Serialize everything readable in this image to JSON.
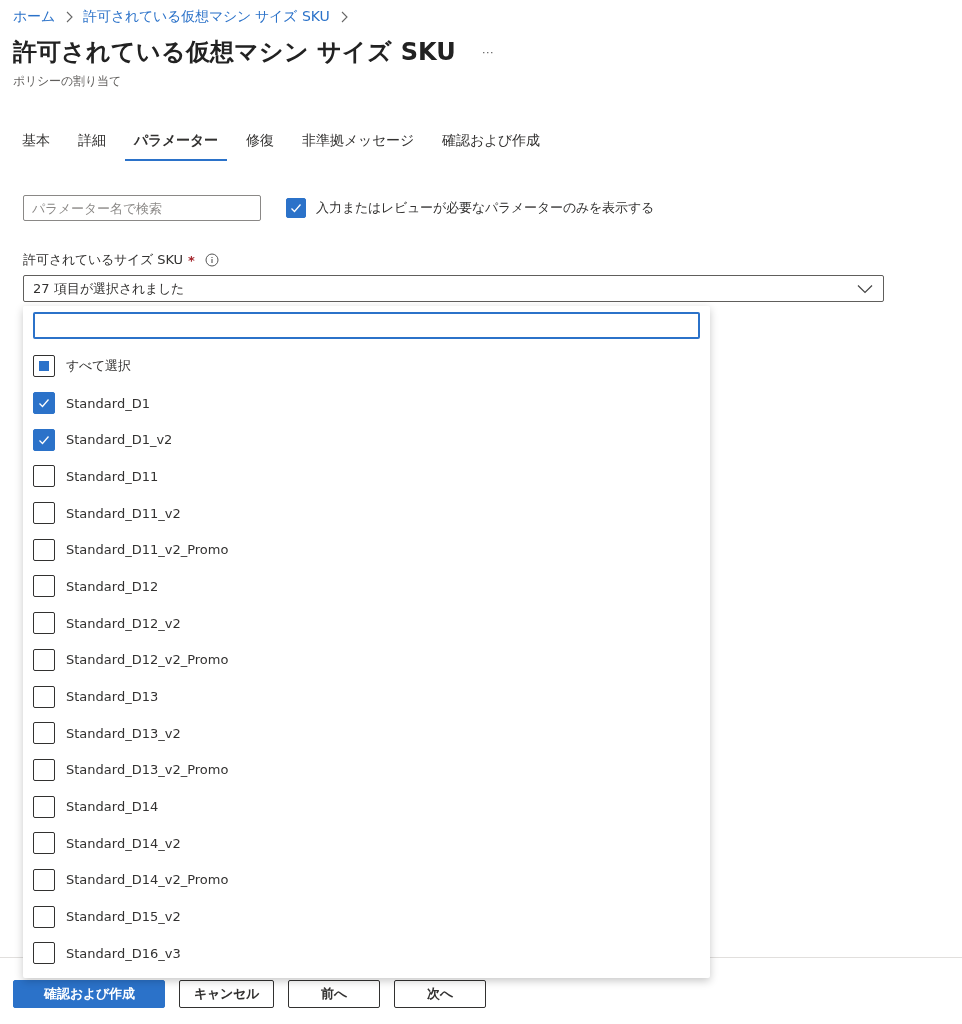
{
  "breadcrumb": [
    "ホーム",
    "許可されている仮想マシン サイズ SKU"
  ],
  "title": "許可されている仮想マシン サイズ SKU",
  "more": "···",
  "subtitle": "ポリシーの割り当て",
  "tabs": [
    {
      "label": "基本",
      "selected": false
    },
    {
      "label": "詳細",
      "selected": false
    },
    {
      "label": "パラメーター",
      "selected": true
    },
    {
      "label": "修復",
      "selected": false
    },
    {
      "label": "非準拠メッセージ",
      "selected": false
    },
    {
      "label": "確認および作成",
      "selected": false
    }
  ],
  "search": {
    "placeholder": "パラメーター名で検索"
  },
  "filter": {
    "label": "入力またはレビューが必要なパラメーターのみを表示する",
    "checked": true
  },
  "parameter": {
    "label": "許可されているサイズ SKU",
    "required_mark": "*",
    "value": "27 項目が選択されました",
    "expanded": true
  },
  "dropdown": {
    "select_all": {
      "label": "すべて選択",
      "partial": true
    },
    "options": [
      {
        "label": "Standard_D1",
        "checked": true
      },
      {
        "label": "Standard_D1_v2",
        "checked": true
      },
      {
        "label": "Standard_D11",
        "checked": false
      },
      {
        "label": "Standard_D11_v2",
        "checked": false
      },
      {
        "label": "Standard_D11_v2_Promo",
        "checked": false
      },
      {
        "label": "Standard_D12",
        "checked": false
      },
      {
        "label": "Standard_D12_v2",
        "checked": false
      },
      {
        "label": "Standard_D12_v2_Promo",
        "checked": false
      },
      {
        "label": "Standard_D13",
        "checked": false
      },
      {
        "label": "Standard_D13_v2",
        "checked": false
      },
      {
        "label": "Standard_D13_v2_Promo",
        "checked": false
      },
      {
        "label": "Standard_D14",
        "checked": false
      },
      {
        "label": "Standard_D14_v2",
        "checked": false
      },
      {
        "label": "Standard_D14_v2_Promo",
        "checked": false
      },
      {
        "label": "Standard_D15_v2",
        "checked": false
      },
      {
        "label": "Standard_D16_v3",
        "checked": false
      }
    ]
  },
  "footer_buttons": [
    {
      "label": "確認および作成",
      "kind": "primary"
    },
    {
      "label": "キャンセル",
      "kind": "secondary"
    },
    {
      "label": "前へ",
      "kind": "secondary"
    },
    {
      "label": "次へ",
      "kind": "secondary"
    }
  ]
}
